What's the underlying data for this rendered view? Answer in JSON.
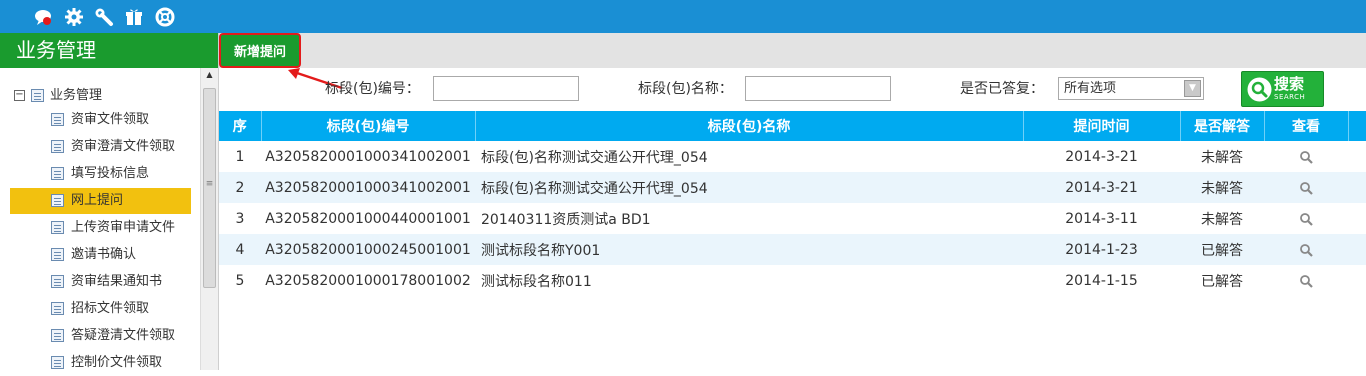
{
  "topbar": {
    "icons": [
      "chat-icon",
      "gear-icon",
      "wrench-icon",
      "gift-icon",
      "lifebuoy-icon"
    ]
  },
  "sidebar": {
    "title": "业务管理",
    "root_label": "业务管理",
    "items": [
      {
        "label": "资审文件领取"
      },
      {
        "label": "资审澄清文件领取"
      },
      {
        "label": "填写投标信息"
      },
      {
        "label": "网上提问",
        "active": true
      },
      {
        "label": "上传资审申请文件"
      },
      {
        "label": "邀请书确认"
      },
      {
        "label": "资审结果通知书"
      },
      {
        "label": "招标文件领取"
      },
      {
        "label": "答疑澄清文件领取"
      },
      {
        "label": "控制价文件领取"
      }
    ]
  },
  "toolbar": {
    "add_label": "新增提问"
  },
  "filters": {
    "code_label": "标段(包)编号：",
    "code_value": "",
    "name_label": "标段(包)名称：",
    "name_value": "",
    "answered_label": "是否已答复：",
    "answered_value": "所有选项"
  },
  "search": {
    "label": "搜索",
    "sublabel": "SEARCH"
  },
  "accent": {
    "green": "#1a9b2e",
    "blue": "#00aaf0",
    "topbar": "#1a8fd4",
    "highlight": "#f2c10f",
    "annotation": "#e31b1b"
  },
  "table": {
    "headers": [
      "序",
      "标段(包)编号",
      "标段(包)名称",
      "提问时间",
      "是否解答",
      "查看"
    ],
    "rows": [
      {
        "no": "1",
        "code": "A3205820001000341002001",
        "name": "标段(包)名称测试交通公开代理_054",
        "time": "2014-3-21",
        "answered": "未解答"
      },
      {
        "no": "2",
        "code": "A3205820001000341002001",
        "name": "标段(包)名称测试交通公开代理_054",
        "time": "2014-3-21",
        "answered": "未解答"
      },
      {
        "no": "3",
        "code": "A3205820001000440001001",
        "name": "20140311资质测试a BD1",
        "time": "2014-3-11",
        "answered": "未解答"
      },
      {
        "no": "4",
        "code": "A3205820001000245001001",
        "name": "测试标段名称Y001",
        "time": "2014-1-23",
        "answered": "已解答"
      },
      {
        "no": "5",
        "code": "A3205820001000178001002",
        "name": "测试标段名称011",
        "time": "2014-1-15",
        "answered": "已解答"
      }
    ]
  }
}
